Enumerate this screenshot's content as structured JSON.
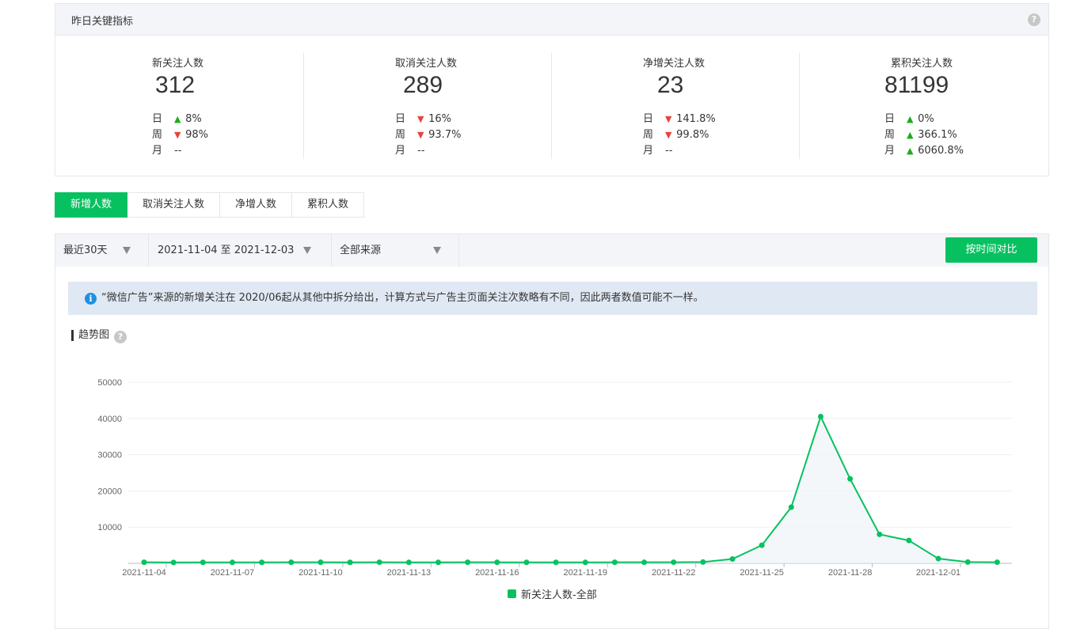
{
  "card": {
    "title": "昨日关键指标",
    "help": "?",
    "metrics": [
      {
        "title": "新关注人数",
        "value": "312",
        "rows": [
          {
            "k": "日",
            "dir": "up",
            "pct": "8%"
          },
          {
            "k": "周",
            "dir": "down",
            "pct": "98%"
          },
          {
            "k": "月",
            "dir": "",
            "pct": "--"
          }
        ]
      },
      {
        "title": "取消关注人数",
        "value": "289",
        "rows": [
          {
            "k": "日",
            "dir": "down",
            "pct": "16%"
          },
          {
            "k": "周",
            "dir": "down",
            "pct": "93.7%"
          },
          {
            "k": "月",
            "dir": "",
            "pct": "--"
          }
        ]
      },
      {
        "title": "净增关注人数",
        "value": "23",
        "rows": [
          {
            "k": "日",
            "dir": "down",
            "pct": "141.8%"
          },
          {
            "k": "周",
            "dir": "down",
            "pct": "99.8%"
          },
          {
            "k": "月",
            "dir": "",
            "pct": "--"
          }
        ]
      },
      {
        "title": "累积关注人数",
        "value": "81199",
        "rows": [
          {
            "k": "日",
            "dir": "up",
            "pct": "0%"
          },
          {
            "k": "周",
            "dir": "up",
            "pct": "366.1%"
          },
          {
            "k": "月",
            "dir": "up",
            "pct": "6060.8%"
          }
        ]
      }
    ]
  },
  "tabs": [
    "新增人数",
    "取消关注人数",
    "净增人数",
    "累积人数"
  ],
  "active_tab": 0,
  "filters": {
    "period": "最近30天",
    "date_range": "2021-11-04 至 2021-12-03",
    "source": "全部来源",
    "compare_button": "按时间对比"
  },
  "notice": "“微信广告”来源的新增关注在 2020/06起从其他中拆分给出，计算方式与广告主页面关注次数略有不同，因此两者数值可能不一样。",
  "trend_title": "趋势图",
  "colors": {
    "accent": "#07c160",
    "up": "#1aad19",
    "down": "#e64340"
  },
  "chart_data": {
    "type": "line",
    "x": [
      "2021-11-04",
      "2021-11-05",
      "2021-11-06",
      "2021-11-07",
      "2021-11-08",
      "2021-11-09",
      "2021-11-10",
      "2021-11-11",
      "2021-11-12",
      "2021-11-13",
      "2021-11-14",
      "2021-11-15",
      "2021-11-16",
      "2021-11-17",
      "2021-11-18",
      "2021-11-19",
      "2021-11-20",
      "2021-11-21",
      "2021-11-22",
      "2021-11-23",
      "2021-11-24",
      "2021-11-25",
      "2021-11-26",
      "2021-11-27",
      "2021-11-28",
      "2021-11-29",
      "2021-11-30",
      "2021-12-01",
      "2021-12-02",
      "2021-12-03"
    ],
    "series": [
      {
        "name": "新关注人数-全部",
        "values": [
          300,
          250,
          280,
          260,
          270,
          290,
          300,
          280,
          310,
          260,
          280,
          300,
          290,
          270,
          280,
          260,
          300,
          290,
          310,
          350,
          1200,
          5000,
          15500,
          40500,
          23300,
          8000,
          6300,
          1300,
          350,
          312
        ]
      }
    ],
    "xticks": [
      "2021-11-04",
      "2021-11-07",
      "2021-11-10",
      "2021-11-13",
      "2021-11-16",
      "2021-11-19",
      "2021-11-22",
      "2021-11-25",
      "2021-11-28",
      "2021-12-01"
    ],
    "yticks": [
      10000,
      20000,
      30000,
      40000,
      50000
    ],
    "ylim": [
      0,
      50000
    ],
    "legend_position": "bottom",
    "grid": true
  }
}
